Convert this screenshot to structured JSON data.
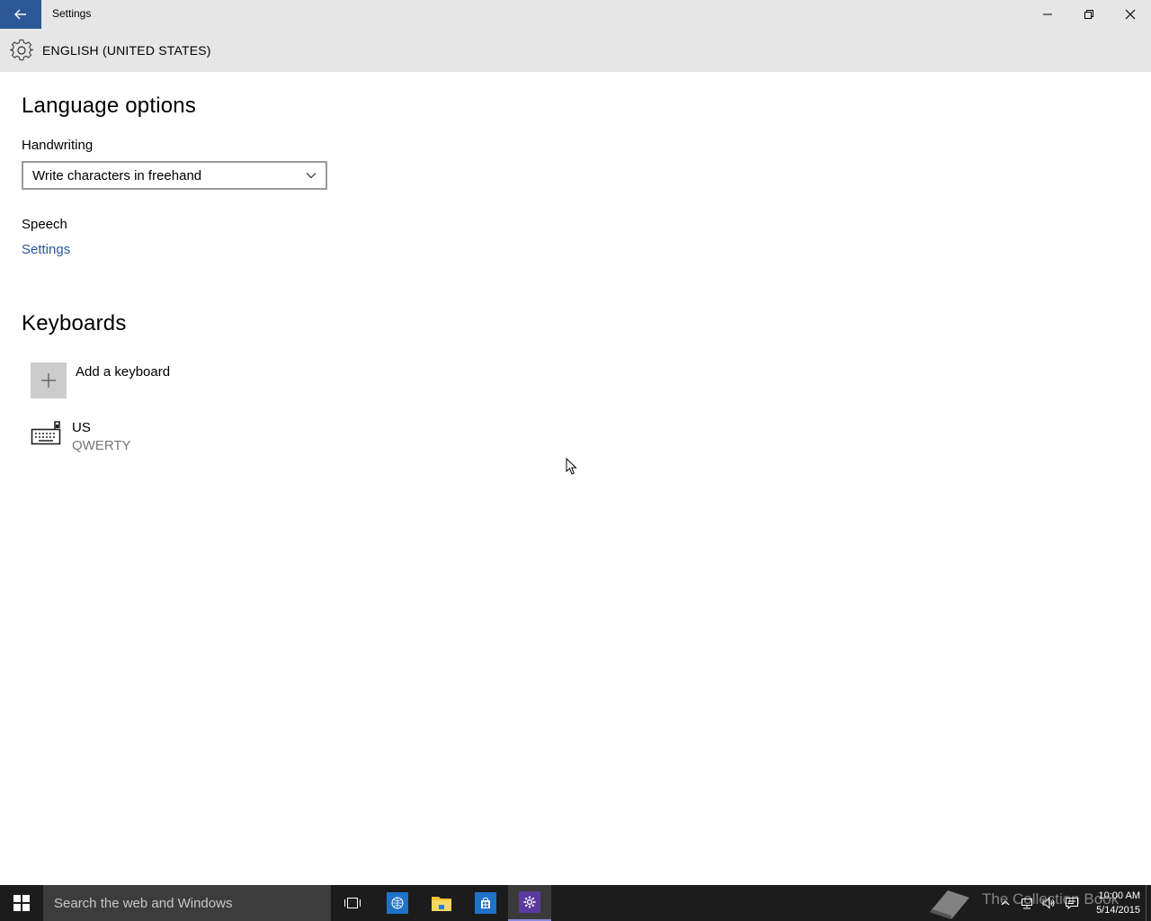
{
  "window": {
    "title": "Settings"
  },
  "header": {
    "title": "ENGLISH (UNITED STATES)"
  },
  "language_options": {
    "heading": "Language options",
    "handwriting_label": "Handwriting",
    "handwriting_value": "Write characters in freehand",
    "speech_label": "Speech",
    "speech_link": "Settings"
  },
  "keyboards": {
    "heading": "Keyboards",
    "add_label": "Add a keyboard",
    "items": [
      {
        "name": "US",
        "layout": "QWERTY"
      }
    ]
  },
  "taskbar": {
    "search_placeholder": "Search the web and Windows",
    "time": "10:00 AM",
    "date": "5/14/2015",
    "watermark": "The Collection Book"
  },
  "colors": {
    "accent": "#2b5797",
    "chrome": "#e6e6e6",
    "taskbar": "#1c1c1c",
    "settings_tile": "#5b3b9e"
  }
}
